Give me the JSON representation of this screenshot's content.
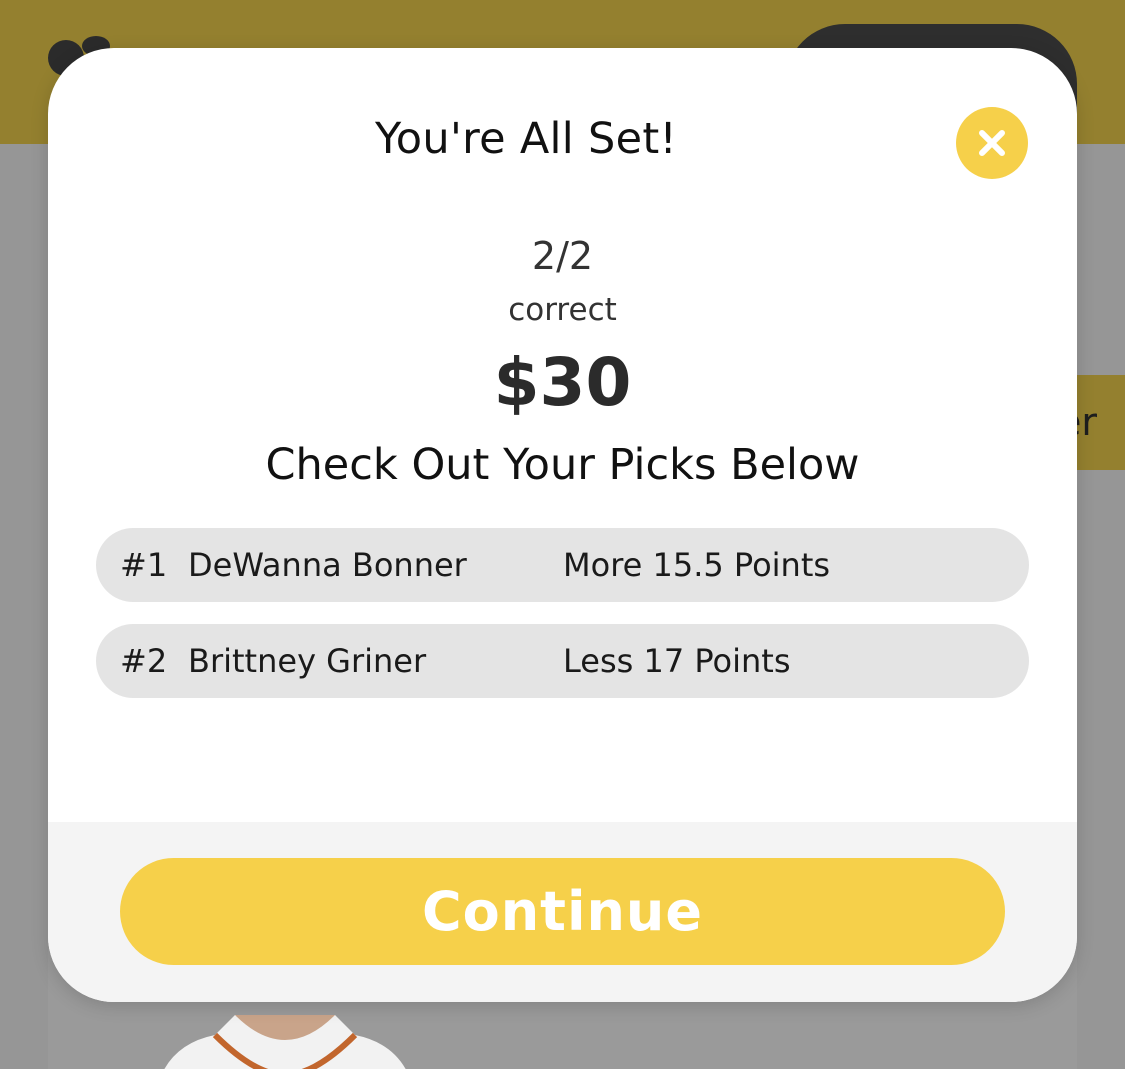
{
  "colors": {
    "accent": "#f6d04a",
    "backdrop": "#969696",
    "header_dimmed": "#94802f",
    "pick_row_bg": "#e4e4e4",
    "footer_bg": "#f4f4f4"
  },
  "background": {
    "side_button_text": "er"
  },
  "modal": {
    "title": "You're All Set!",
    "close_icon": "close-icon",
    "score": "2/2",
    "score_label": "correct",
    "prize": "$30",
    "subtitle": "Check Out Your Picks Below",
    "picks": [
      {
        "number": "#1",
        "player": "DeWanna Bonner",
        "line": "More 15.5 Points"
      },
      {
        "number": "#2",
        "player": "Brittney Griner",
        "line": "Less 17 Points"
      }
    ],
    "continue_label": "Continue"
  }
}
